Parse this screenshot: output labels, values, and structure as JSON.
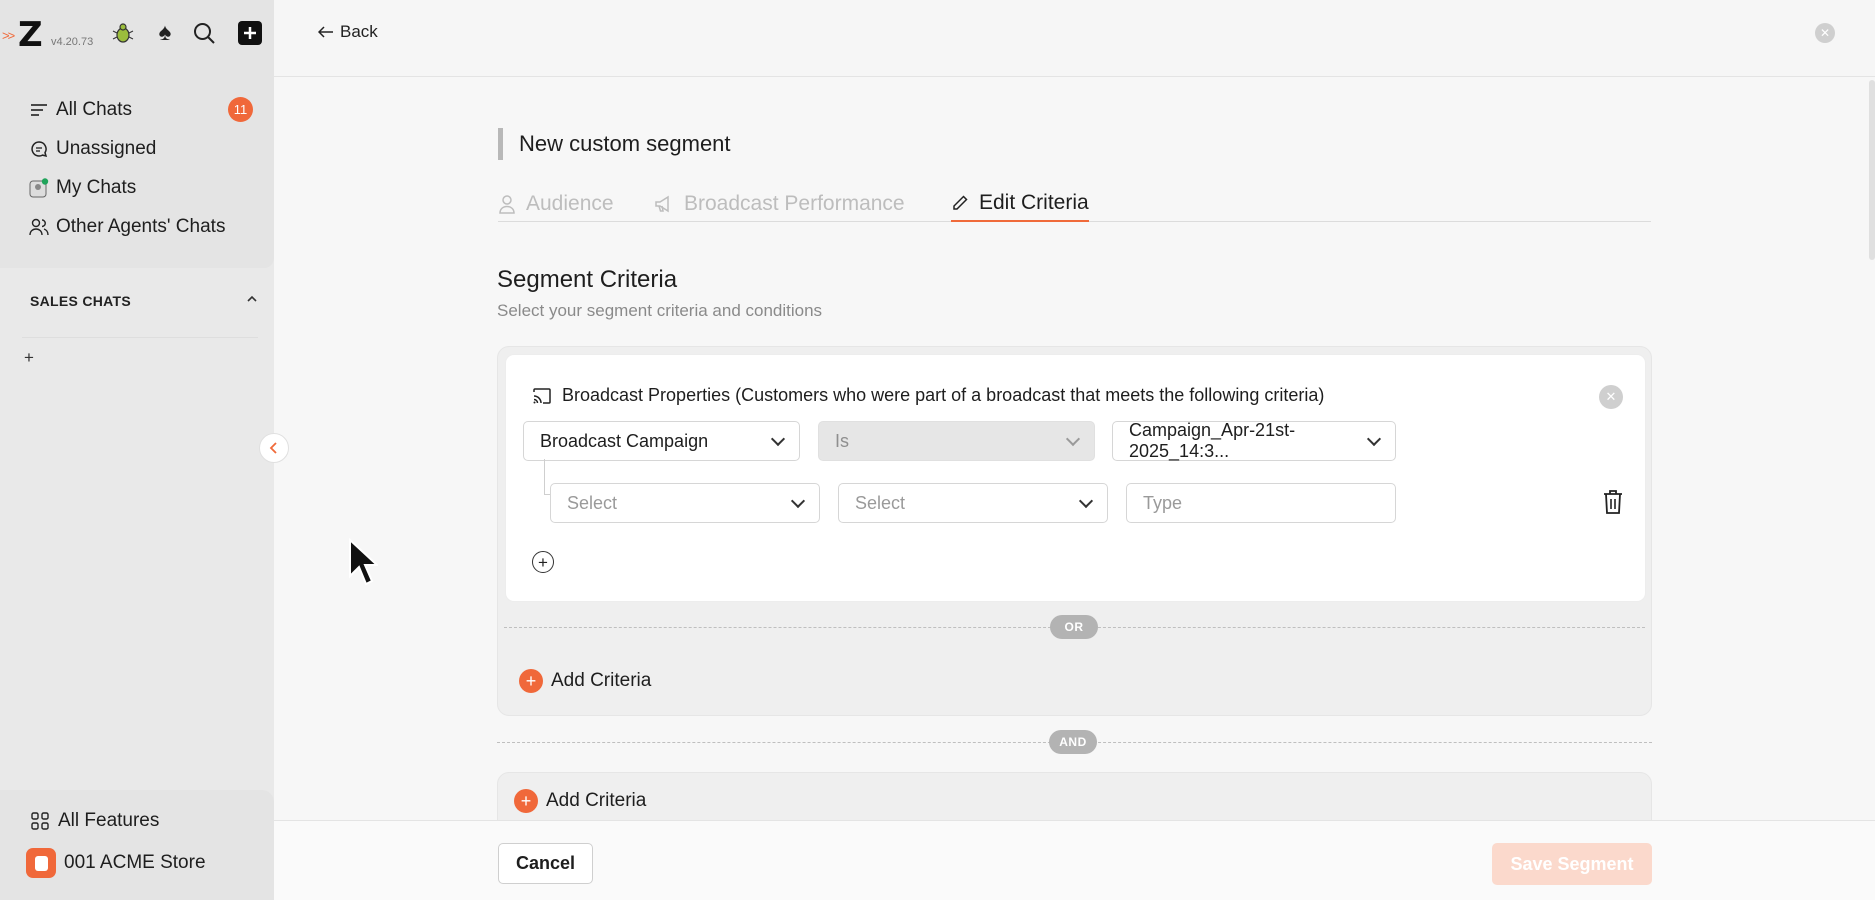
{
  "app": {
    "version": "v4.20.73"
  },
  "sidebar": {
    "nav": [
      {
        "label": "All Chats",
        "badge": "11"
      },
      {
        "label": "Unassigned"
      },
      {
        "label": "My Chats"
      },
      {
        "label": "Other Agents' Chats"
      }
    ],
    "section_title": "SALES CHATS",
    "bottom": {
      "features": "All Features",
      "store": "001 ACME Store"
    }
  },
  "header": {
    "back_label": "Back"
  },
  "page": {
    "title": "New custom segment",
    "tabs": [
      {
        "label": "Audience",
        "active": false
      },
      {
        "label": "Broadcast Performance",
        "active": false
      },
      {
        "label": "Edit Criteria",
        "active": true
      }
    ]
  },
  "criteria": {
    "title": "Segment Criteria",
    "subtitle": "Select your segment criteria and conditions",
    "card_title": "Broadcast Properties (Customers who were part of a broadcast that meets the following criteria)",
    "row1": {
      "field": "Broadcast Campaign",
      "operator": "Is",
      "value": "Campaign_Apr-21st-2025_14:3..."
    },
    "row2": {
      "field": "Select",
      "operator": "Select",
      "value_placeholder": "Type"
    },
    "or_label": "OR",
    "and_label": "AND",
    "add_criteria": "Add Criteria"
  },
  "footer": {
    "cancel": "Cancel",
    "save": "Save Segment"
  },
  "colors": {
    "accent": "#f0683a",
    "save_disabled": "#fbd9cc"
  }
}
